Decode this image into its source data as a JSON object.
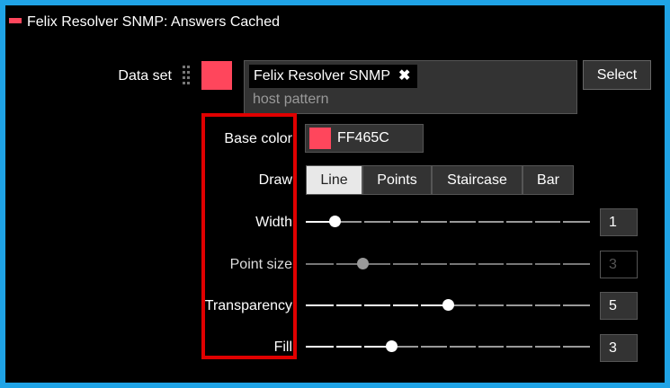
{
  "panel": {
    "title": "Felix Resolver SNMP: Answers Cached",
    "accent": "#ff465c",
    "frame_color": "#1fa3e6"
  },
  "dataset": {
    "label": "Data set",
    "tag": "Felix Resolver SNMP",
    "tag_remove": "✖",
    "placeholder": "host pattern",
    "select_label": "Select"
  },
  "base_color": {
    "label": "Base color",
    "value": "FF465C"
  },
  "draw": {
    "label": "Draw",
    "options": [
      "Line",
      "Points",
      "Staircase",
      "Bar"
    ],
    "selected": "Line"
  },
  "width": {
    "label": "Width",
    "value": "1",
    "level": 0.1
  },
  "point_size": {
    "label": "Point size",
    "value": "3",
    "level": 0.2,
    "disabled": true
  },
  "transparency": {
    "label": "Transparency",
    "value": "5",
    "level": 0.5
  },
  "fill": {
    "label": "Fill",
    "value": "3",
    "level": 0.3
  }
}
